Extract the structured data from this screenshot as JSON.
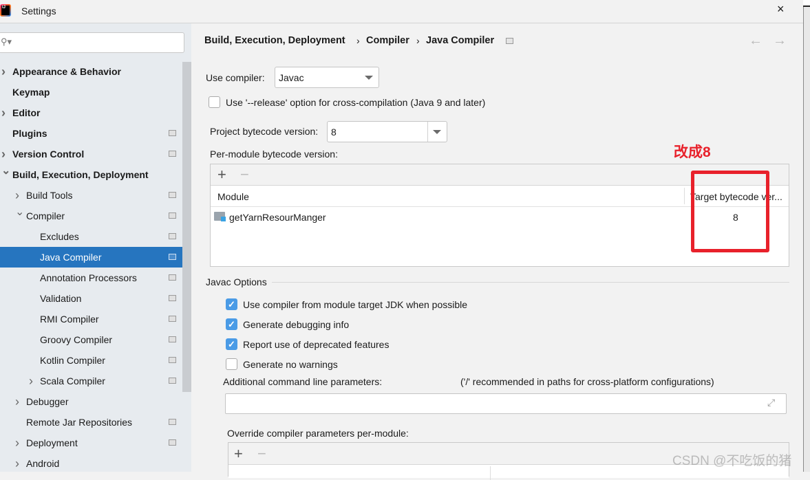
{
  "window": {
    "title": "Settings",
    "close": "×"
  },
  "breadcrumb": [
    "Build, Execution, Deployment",
    "Compiler",
    "Java Compiler"
  ],
  "breadcrumb_sep": "›",
  "nav": {
    "back": "←",
    "forward": "→"
  },
  "sidebar": {
    "search_placeholder": "",
    "items": [
      {
        "label": "Appearance & Behavior",
        "level": 0,
        "arrow": "right",
        "bold": true,
        "page": false
      },
      {
        "label": "Keymap",
        "level": 0,
        "arrow": "",
        "bold": true,
        "page": false
      },
      {
        "label": "Editor",
        "level": 0,
        "arrow": "right",
        "bold": true,
        "page": false
      },
      {
        "label": "Plugins",
        "level": 0,
        "arrow": "",
        "bold": true,
        "page": true
      },
      {
        "label": "Version Control",
        "level": 0,
        "arrow": "right",
        "bold": true,
        "page": true
      },
      {
        "label": "Build, Execution, Deployment",
        "level": 0,
        "arrow": "down",
        "bold": true,
        "page": false
      },
      {
        "label": "Build Tools",
        "level": 1,
        "arrow": "right",
        "bold": false,
        "page": true
      },
      {
        "label": "Compiler",
        "level": 1,
        "arrow": "down",
        "bold": false,
        "page": true
      },
      {
        "label": "Excludes",
        "level": 2,
        "arrow": "",
        "bold": false,
        "page": true
      },
      {
        "label": "Java Compiler",
        "level": 2,
        "arrow": "",
        "bold": false,
        "page": true,
        "selected": true
      },
      {
        "label": "Annotation Processors",
        "level": 2,
        "arrow": "",
        "bold": false,
        "page": true
      },
      {
        "label": "Validation",
        "level": 2,
        "arrow": "",
        "bold": false,
        "page": true
      },
      {
        "label": "RMI Compiler",
        "level": 2,
        "arrow": "",
        "bold": false,
        "page": true
      },
      {
        "label": "Groovy Compiler",
        "level": 2,
        "arrow": "",
        "bold": false,
        "page": true
      },
      {
        "label": "Kotlin Compiler",
        "level": 2,
        "arrow": "",
        "bold": false,
        "page": true
      },
      {
        "label": "Scala Compiler",
        "level": 2,
        "arrow": "right",
        "bold": false,
        "page": true
      },
      {
        "label": "Debugger",
        "level": 1,
        "arrow": "right",
        "bold": false,
        "page": false
      },
      {
        "label": "Remote Jar Repositories",
        "level": 1,
        "arrow": "",
        "bold": false,
        "page": true
      },
      {
        "label": "Deployment",
        "level": 1,
        "arrow": "right",
        "bold": false,
        "page": true
      },
      {
        "label": "Android",
        "level": 1,
        "arrow": "right",
        "bold": false,
        "page": false
      }
    ]
  },
  "main": {
    "use_compiler_label": "Use compiler:",
    "use_compiler_value": "Javac",
    "release_option": {
      "label": "Use '--release' option for cross-compilation (Java 9 and later)",
      "checked": false
    },
    "project_bytecode_label": "Project bytecode version:",
    "project_bytecode_value": "8",
    "per_module_label": "Per-module bytecode version:",
    "add": "+",
    "remove": "−",
    "table": {
      "headers": [
        "Module",
        "Target bytecode ver..."
      ],
      "rows": [
        {
          "module": "getYarnResourManger",
          "target": "8"
        }
      ]
    },
    "annotation": {
      "text": "改成8",
      "color": "#e8212b"
    },
    "javac_options_title": "Javac Options",
    "options": [
      {
        "label": "Use compiler from module target JDK when possible",
        "checked": true
      },
      {
        "label": "Generate debugging info",
        "checked": true
      },
      {
        "label": "Report use of deprecated features",
        "checked": true
      },
      {
        "label": "Generate no warnings",
        "checked": false
      }
    ],
    "additional_params_label": "Additional command line parameters:",
    "additional_params_hint": "('/' recommended in paths for cross-platform configurations)",
    "additional_params_value": "",
    "override_label": "Override compiler parameters per-module:"
  },
  "watermark": "CSDN @不吃饭的猪",
  "colors": {
    "selection": "#2675bf",
    "checkbox": "#4a9be6",
    "annotation": "#e8212b"
  }
}
